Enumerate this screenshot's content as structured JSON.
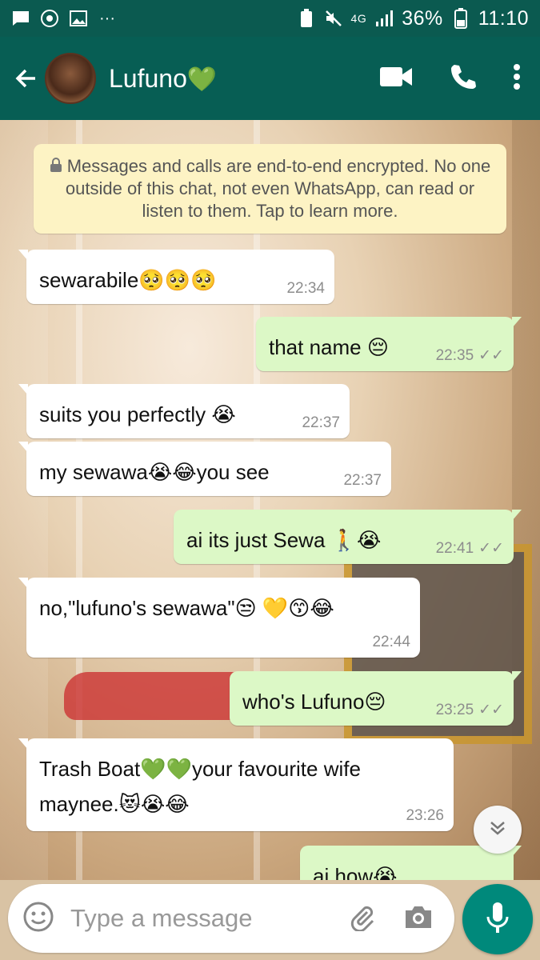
{
  "status_bar": {
    "battery": "36%",
    "time": "11:10",
    "network": "4G"
  },
  "header": {
    "contact_name": "Lufuno",
    "contact_emoji": "💚"
  },
  "encryption_notice": "Messages and calls are end-to-end encrypted. No one outside of this chat, not even WhatsApp, can read or listen to them. Tap to learn more.",
  "messages": [
    {
      "dir": "in",
      "text": "sewarabile🥺🥺🥺",
      "time": "22:34"
    },
    {
      "dir": "out",
      "text": "that name 😔",
      "time": "22:35",
      "ticks": "✓✓"
    },
    {
      "dir": "in",
      "text": "suits you perfectly 😭",
      "time": "22:37"
    },
    {
      "dir": "in",
      "text": "my sewawa😭😂you see",
      "time": "22:37"
    },
    {
      "dir": "out",
      "text": "ai its just Sewa 🚶😭",
      "time": "22:41",
      "ticks": "✓✓"
    },
    {
      "dir": "in",
      "text": "no,\"lufuno's sewawa\"😒 💛😙😂",
      "time": "22:44"
    },
    {
      "dir": "out",
      "text": "who's Lufuno😔",
      "time": "23:25",
      "ticks": "✓✓"
    },
    {
      "dir": "in",
      "text": "Trash Boat💚💚your favourite wife\nmaynee.😻😭😂",
      "time": "23:26"
    },
    {
      "dir": "out",
      "text": "ai how😭",
      "time": "",
      "ticks": ""
    }
  ],
  "composer": {
    "placeholder": "Type a message"
  },
  "colors": {
    "header": "#075e54",
    "status_bar": "#0b5a50",
    "outgoing_bubble": "#dcf8c6",
    "incoming_bubble": "#ffffff",
    "notice": "#fdf3c4",
    "mic_button": "#00897b"
  },
  "icons": [
    "chat-icon",
    "music-icon",
    "gallery-icon",
    "more-dots-icon",
    "battery-saver-icon",
    "mute-icon",
    "signal-icon",
    "battery-icon",
    "back-arrow-icon",
    "video-call-icon",
    "phone-icon",
    "overflow-menu-icon",
    "lock-icon",
    "emoji-icon",
    "attach-icon",
    "camera-icon",
    "mic-icon",
    "scroll-down-icon",
    "double-tick-icon"
  ]
}
